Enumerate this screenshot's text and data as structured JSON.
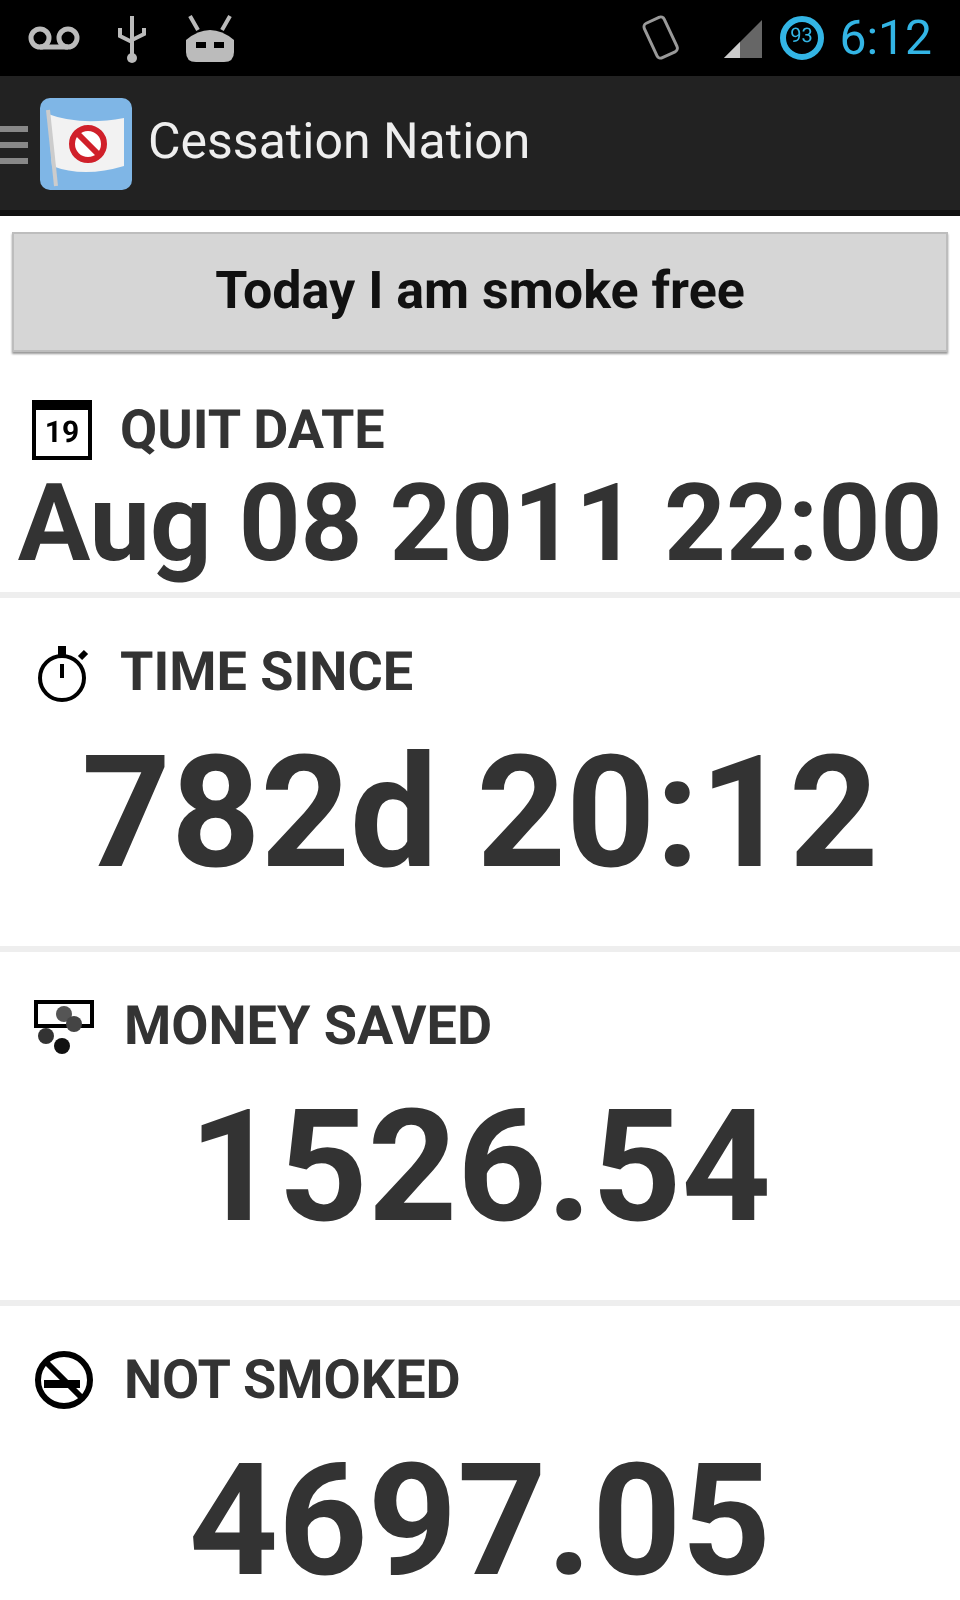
{
  "status_bar": {
    "battery": "93",
    "time": "6:12"
  },
  "action_bar": {
    "title": "Cessation Nation"
  },
  "smoke_free_button": {
    "label": "Today I am smoke free"
  },
  "stats": [
    {
      "kind": "date",
      "icon_text": "19",
      "label": "QUIT DATE",
      "value": "Aug 08 2011 22:00"
    },
    {
      "kind": "number",
      "label": "TIME SINCE",
      "value": "782d 20:12"
    },
    {
      "kind": "number",
      "label": "MONEY SAVED",
      "value": "1526.54"
    },
    {
      "kind": "number",
      "label": "NOT SMOKED",
      "value": "4697.05"
    }
  ]
}
